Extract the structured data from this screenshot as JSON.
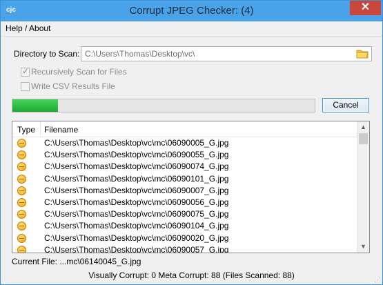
{
  "window": {
    "icon_text": "cjc",
    "title": "Corrupt JPEG Checker: (4)",
    "close_label": "✕"
  },
  "menu": {
    "help_about": "Help / About"
  },
  "form": {
    "directory_label": "Directory to Scan:",
    "directory_value": "C:\\Users\\Thomas\\Desktop\\vc\\",
    "recursive_label": "Recursively Scan for Files",
    "recursive_checked": true,
    "csv_label": "Write CSV Results File",
    "csv_checked": false
  },
  "progress": {
    "percent": 15
  },
  "buttons": {
    "cancel": "Cancel"
  },
  "table": {
    "headers": {
      "type": "Type",
      "filename": "Filename"
    },
    "rows": [
      {
        "type_icon": "warning-face-icon",
        "filename": "C:\\Users\\Thomas\\Desktop\\vc\\mc\\06090005_G.jpg"
      },
      {
        "type_icon": "warning-face-icon",
        "filename": "C:\\Users\\Thomas\\Desktop\\vc\\mc\\06090055_G.jpg"
      },
      {
        "type_icon": "warning-face-icon",
        "filename": "C:\\Users\\Thomas\\Desktop\\vc\\mc\\06090074_G.jpg"
      },
      {
        "type_icon": "warning-face-icon",
        "filename": "C:\\Users\\Thomas\\Desktop\\vc\\mc\\06090101_G.jpg"
      },
      {
        "type_icon": "warning-face-icon",
        "filename": "C:\\Users\\Thomas\\Desktop\\vc\\mc\\06090007_G.jpg"
      },
      {
        "type_icon": "warning-face-icon",
        "filename": "C:\\Users\\Thomas\\Desktop\\vc\\mc\\06090056_G.jpg"
      },
      {
        "type_icon": "warning-face-icon",
        "filename": "C:\\Users\\Thomas\\Desktop\\vc\\mc\\06090075_G.jpg"
      },
      {
        "type_icon": "warning-face-icon",
        "filename": "C:\\Users\\Thomas\\Desktop\\vc\\mc\\06090104_G.jpg"
      },
      {
        "type_icon": "warning-face-icon",
        "filename": "C:\\Users\\Thomas\\Desktop\\vc\\mc\\06090020_G.jpg"
      },
      {
        "type_icon": "warning-face-icon",
        "filename": "C:\\Users\\Thomas\\Desktop\\vc\\mc\\06090057_G.jpg"
      }
    ]
  },
  "footer": {
    "current_file": "Current File: ...mc\\06140045_G.jpg",
    "status": "Visually Corrupt: 0 Meta Corrupt: 88 (Files Scanned: 88)"
  },
  "colors": {
    "titlebar": "#4aa3e8",
    "close": "#c9473a",
    "progress_fill": "#1fa831",
    "focus_border": "#3c8fd8"
  }
}
